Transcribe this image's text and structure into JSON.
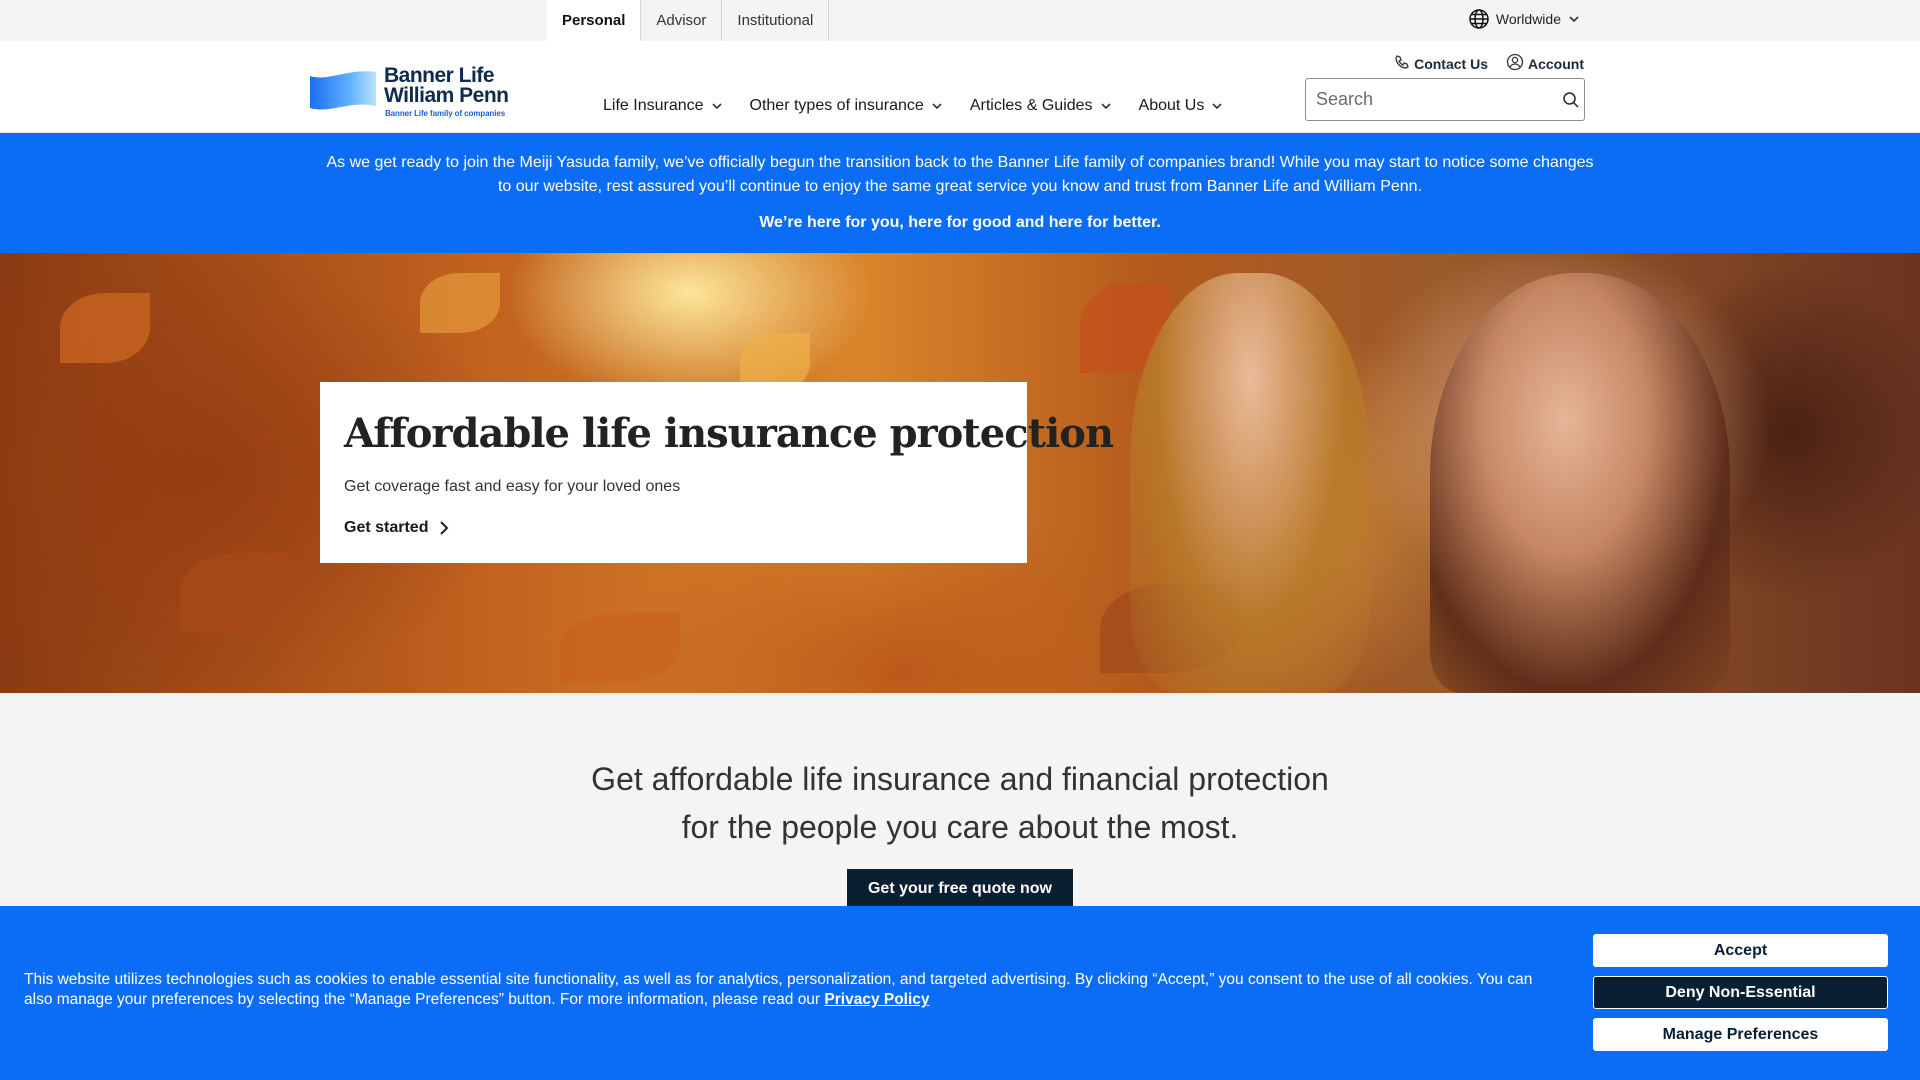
{
  "audience_tabs": [
    {
      "label": "Personal",
      "active": true
    },
    {
      "label": "Advisor",
      "active": false
    },
    {
      "label": "Institutional",
      "active": false
    }
  ],
  "region": {
    "label": "Worldwide",
    "icon": "globe-icon"
  },
  "logo": {
    "line1": "Banner Life",
    "line2": "William Penn",
    "tagline": "Banner Life family of companies"
  },
  "util_links": {
    "contact": "Contact Us",
    "account": "Account"
  },
  "nav": [
    {
      "label": "Life Insurance"
    },
    {
      "label": "Other types of insurance"
    },
    {
      "label": "Articles & Guides"
    },
    {
      "label": "About Us"
    }
  ],
  "search": {
    "placeholder": "Search",
    "value": ""
  },
  "announcement": {
    "text": "As we get ready to join the Meiji Yasuda family, we’ve officially begun the transition back to the Banner Life family of companies brand! While you may start to notice some changes to our website, rest assured you’ll continue to enjoy the same great service you know and trust from Banner Life and William Penn.",
    "strong": "We’re here for you, here for good and here for better."
  },
  "hero": {
    "title": "Affordable life insurance protection",
    "subtitle": "Get coverage fast and easy for your loved ones",
    "cta": "Get started"
  },
  "value_prop": {
    "line1": "Get affordable life insurance and financial protection",
    "line2": "for the people you care about the most.",
    "button": "Get your free quote now"
  },
  "cookie": {
    "text": "This website utilizes technologies such as cookies to enable essential site functionality, as well as for analytics, personalization, and targeted advertising. By clicking “Accept,” you consent to the use of all cookies. You can also manage your preferences by selecting the “Manage Preferences” button. For more information, please read our",
    "link": "Privacy Policy",
    "accept": "Accept",
    "deny": "Deny Non-Essential",
    "manage": "Manage Preferences"
  },
  "colors": {
    "brand_blue": "#0b6df6",
    "navy": "#0b1f33"
  }
}
